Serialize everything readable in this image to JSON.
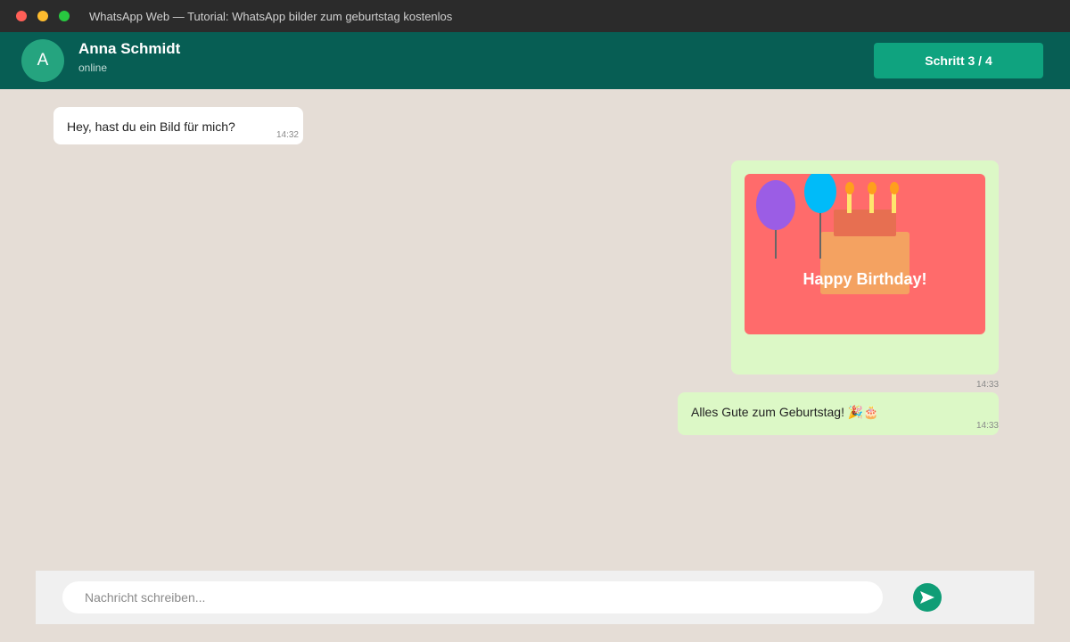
{
  "window": {
    "title": "WhatsApp Web — Tutorial: WhatsApp bilder zum geburtstag kostenlos"
  },
  "chat_header": {
    "avatar_initial": "A",
    "contact_name": "Anna Schmidt",
    "status": "online",
    "step_label": "Schritt 3 / 4",
    "step_current": 3,
    "step_total": 4
  },
  "messages": [
    {
      "direction": "incoming",
      "text": "Hey, hast du ein Bild für mich?",
      "time": "14:32"
    },
    {
      "direction": "outgoing",
      "type": "image",
      "image_caption": "Happy Birthday!",
      "time": "14:33"
    },
    {
      "direction": "outgoing",
      "text": "Alles Gute zum Geburtstag! 🎉🎂",
      "time": "14:33"
    }
  ],
  "composer": {
    "placeholder": "Nachricht schreiben...",
    "value": ""
  },
  "colors": {
    "titlebar": "#2b2b2b",
    "header": "#075e54",
    "accent": "#0fa37f",
    "chat_background": "#e5ddd6",
    "incoming_bubble": "#ffffff",
    "outgoing_bubble": "#dcf8c6",
    "image_background": "#ff6b6b",
    "balloon_purple": "#9b5de5",
    "balloon_blue": "#00bbf9",
    "cake": "#f4a261",
    "cake_top": "#e76f51"
  },
  "icons": {
    "send": "send-arrow-icon"
  }
}
